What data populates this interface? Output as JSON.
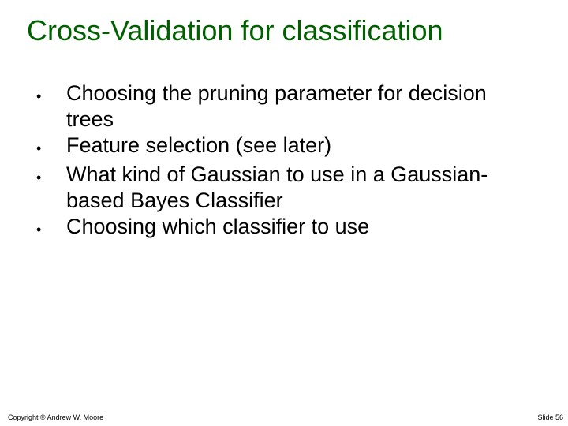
{
  "title": "Cross-Validation for classification",
  "bullets": [
    "Choosing the pruning parameter for decision trees",
    "Feature selection (see later)",
    "What kind of Gaussian to use in a Gaussian-based Bayes Classifier",
    "Choosing which classifier to use"
  ],
  "footer": {
    "copyright": "Copyright © Andrew W. Moore",
    "slide": "Slide 56"
  }
}
